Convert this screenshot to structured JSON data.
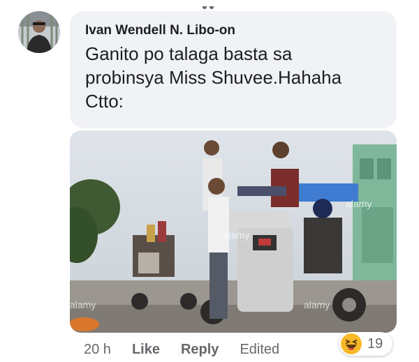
{
  "comment": {
    "author": "Ivan Wendell N. Libo-on",
    "text": "Ganito po talaga basta sa\nprobinsya Miss Shuvee.Hahaha\nCtto:",
    "time": "20 h",
    "like_label": "Like",
    "reply_label": "Reply",
    "edited_label": "Edited",
    "reaction": {
      "icon": "haha-emoji-icon",
      "count": "19"
    }
  },
  "photo": {
    "watermark": "alamy"
  },
  "colors": {
    "bubble": "#f0f2f5",
    "meta_text": "#65676b",
    "author_text": "#1c1e21",
    "haha_emoji": "#f7b928"
  }
}
